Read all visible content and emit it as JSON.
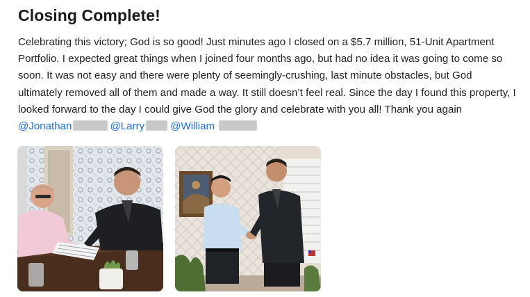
{
  "post": {
    "title": "Closing Complete!",
    "body_text": "Celebrating this victory; God is so good! Just minutes ago I closed on a $5.7 million, 51-Unit Apartment Portfolio. I expected great things when I joined four months ago, but had no idea it was going to come so soon. It was not easy and there were plenty of seemingly-crushing, last minute obstacles, but God ultimately removed all of them and made a way. It still doesn’t feel real. Since the day I found this property, I looked forward to the day I could give God the glory and celebrate with you all! Thank you again",
    "mentions": [
      {
        "name": "@Jonathan"
      },
      {
        "name": "@Larry"
      },
      {
        "name": "@William"
      }
    ],
    "images": [
      {
        "subject": "two men signing closing documents at a table"
      },
      {
        "subject": "two men shaking hands in a living room"
      }
    ]
  },
  "colors": {
    "mention": "#1f6fd6",
    "title": "#1a1a1a",
    "text": "#222222"
  }
}
